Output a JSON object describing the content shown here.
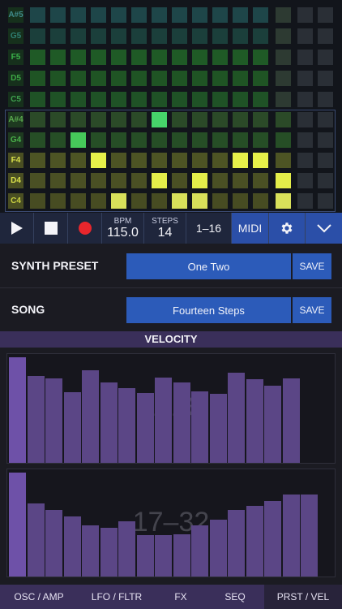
{
  "grid": {
    "notes": [
      "A#5",
      "G5",
      "F5",
      "D5",
      "C5",
      "A#4",
      "G4",
      "F4",
      "D4",
      "C4"
    ],
    "note_colors": [
      "#3f8a8a",
      "#2f7f72",
      "#3ab34a",
      "#3ea845",
      "#3fa04e",
      "#5aa84e",
      "#4ab04a",
      "#d8e04a",
      "#d8e04a",
      "#c8d040"
    ],
    "active_steps": [
      {
        "row": 5,
        "step": 6
      },
      {
        "row": 6,
        "step": 2
      },
      {
        "row": 7,
        "steps": [
          3,
          10,
          11
        ]
      },
      {
        "row": 8,
        "steps": [
          6,
          8,
          12
        ]
      },
      {
        "row": 9,
        "steps": [
          4,
          7,
          8,
          12
        ]
      }
    ]
  },
  "transport": {
    "play_icon": "play-icon",
    "stop_icon": "stop-icon",
    "record_icon": "record-icon",
    "bpm_label": "BPM",
    "bpm_value": "115.0",
    "steps_label": "STEPS",
    "steps_value": "14",
    "range": "1–16",
    "midi": "MIDI",
    "settings_icon": "gear-icon",
    "collapse_icon": "chevron-down-icon"
  },
  "synth_preset": {
    "label": "SYNTH PRESET",
    "value": "One Two",
    "save": "SAVE"
  },
  "song": {
    "label": "SONG",
    "value": "Fourteen Steps",
    "save": "SAVE"
  },
  "velocity": {
    "header": "VELOCITY",
    "panel1_label": "1–16",
    "panel1_values": [
      1.0,
      0.82,
      0.8,
      0.67,
      0.88,
      0.76,
      0.71,
      0.66,
      0.81,
      0.76,
      0.68,
      0.65,
      0.85,
      0.79,
      0.73,
      0.8
    ],
    "panel2_label": "17–32",
    "panel2_values": [
      1.0,
      0.7,
      0.64,
      0.58,
      0.49,
      0.47,
      0.53,
      0.4,
      0.4,
      0.41,
      0.49,
      0.55,
      0.64,
      0.68,
      0.73,
      0.79,
      0.79
    ]
  },
  "tabs": {
    "items": [
      "OSC / AMP",
      "LFO / FLTR",
      "FX",
      "SEQ",
      "PRST / VEL"
    ],
    "active": 4
  }
}
